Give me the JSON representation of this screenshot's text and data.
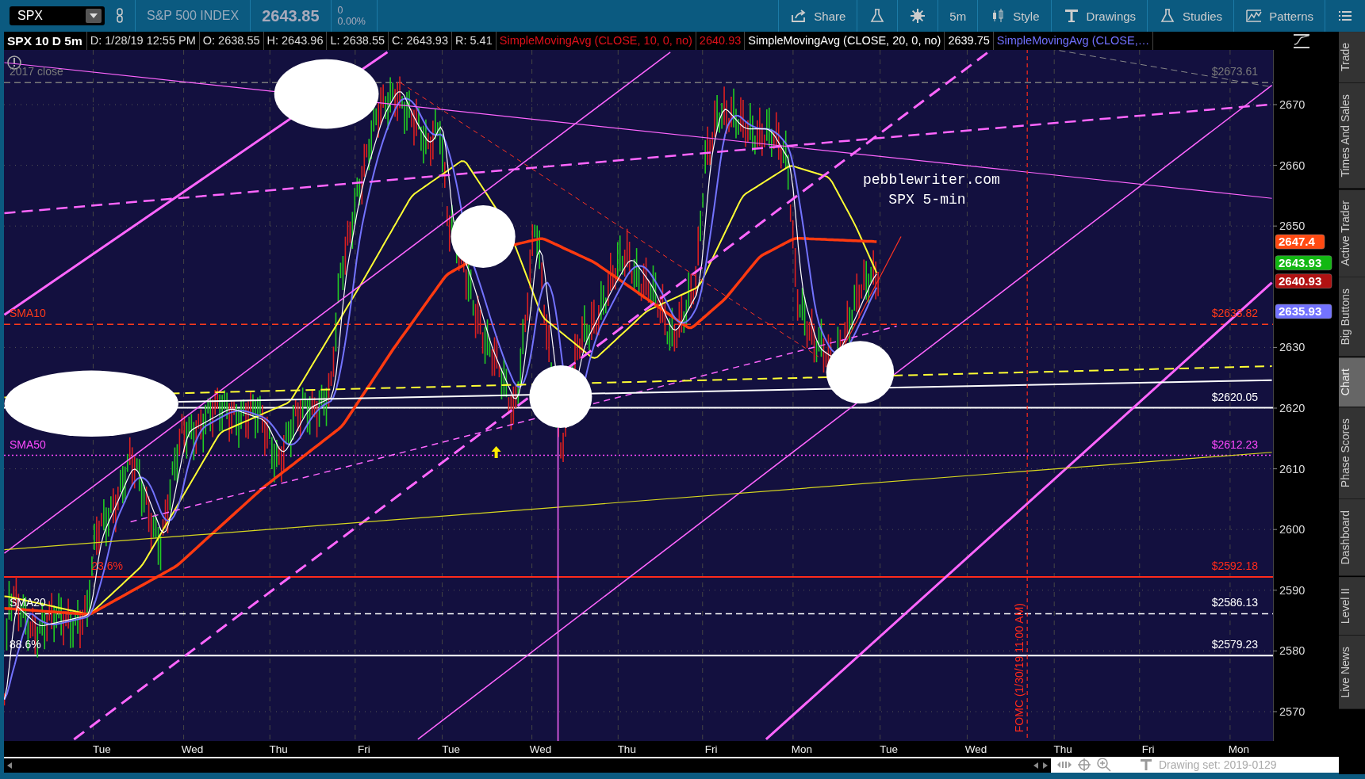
{
  "toolbar": {
    "symbol": "SPX",
    "description": "S&P 500 INDEX",
    "last": "2643.85",
    "change": "0",
    "change_pct": "0.00%",
    "buttons": [
      {
        "kind": "share",
        "label": "Share"
      },
      {
        "kind": "flask"
      },
      {
        "kind": "gear"
      },
      {
        "kind": "plain",
        "label": "5m"
      },
      {
        "kind": "style",
        "label": "Style"
      },
      {
        "kind": "drawings",
        "label": "Drawings"
      },
      {
        "kind": "studies",
        "label": "Studies"
      },
      {
        "kind": "patterns",
        "label": "Patterns"
      },
      {
        "kind": "menu"
      }
    ]
  },
  "header": {
    "title": "SPX 10 D 5m",
    "fields": [
      "D: 1/28/19 12:55 PM",
      "O: 2638.55",
      "H: 2643.96",
      "L: 2638.55",
      "C: 2643.93",
      "R: 5.41"
    ],
    "studies": [
      {
        "name": "SimpleMovingAvg (CLOSE, 10, 0, no)",
        "value": "2640.93"
      },
      {
        "name": "SimpleMovingAvg (CLOSE, 20, 0, no)",
        "value": "2639.75"
      },
      {
        "name": "SimpleMovingAvg (CLOSE,…"
      }
    ]
  },
  "chart": {
    "price_ticks": [
      "2670",
      "2660",
      "2650",
      "2630",
      "2620",
      "2610",
      "2600",
      "2590",
      "2580",
      "2570"
    ],
    "time_ticks": [
      "Tue",
      "Wed",
      "Thu",
      "Fri",
      "Tue",
      "Wed",
      "Thu",
      "Fri",
      "Mon",
      "Tue",
      "Wed",
      "Thu",
      "Fri",
      "Mon"
    ],
    "price_badges": [
      {
        "text": "2647.4",
        "color": "#ff4a12"
      },
      {
        "text": "2643.93",
        "color": "#12b812"
      },
      {
        "text": "2640.93",
        "color": "#b01212"
      },
      {
        "text": "2635.93",
        "color": "#7373ff"
      }
    ],
    "levels": [
      {
        "label": "2017 close",
        "value": "$2673.61",
        "color": "#7a7a7a"
      },
      {
        "label": "SMA10",
        "value": "$2633.82",
        "color": "#ff3a1a"
      },
      {
        "value": "$2620.05",
        "color": "#ffffff"
      },
      {
        "label": "SMA50",
        "value": "$2612.23",
        "color": "#ff4aff"
      },
      {
        "label": "23.6%",
        "value": "$2592.18",
        "color": "#ff2a1a"
      },
      {
        "label": "SMA20",
        "value": "$2586.13",
        "color": "#ffffff"
      },
      {
        "label": "88.6%",
        "value": "$2579.23",
        "color": "#ffffff"
      }
    ],
    "watermark": [
      "pebblewriter.com",
      "SPX 5-min"
    ],
    "event_label": "FOMC (1/30/19 11:00 AM)"
  },
  "sidebar": [
    {
      "label": "Trade",
      "selected": false
    },
    {
      "label": "Times And Sales",
      "selected": false
    },
    {
      "label": "Active Trader",
      "selected": false
    },
    {
      "label": "Big Buttons",
      "selected": false
    },
    {
      "label": "Chart",
      "selected": true
    },
    {
      "label": "Phase Scores",
      "selected": false
    },
    {
      "label": "Dashboard",
      "selected": false
    },
    {
      "label": "Level II",
      "selected": false
    },
    {
      "label": "Live News",
      "selected": false
    }
  ],
  "status_bar": {
    "drawing_set": "Drawing set: 2019-0129"
  }
}
